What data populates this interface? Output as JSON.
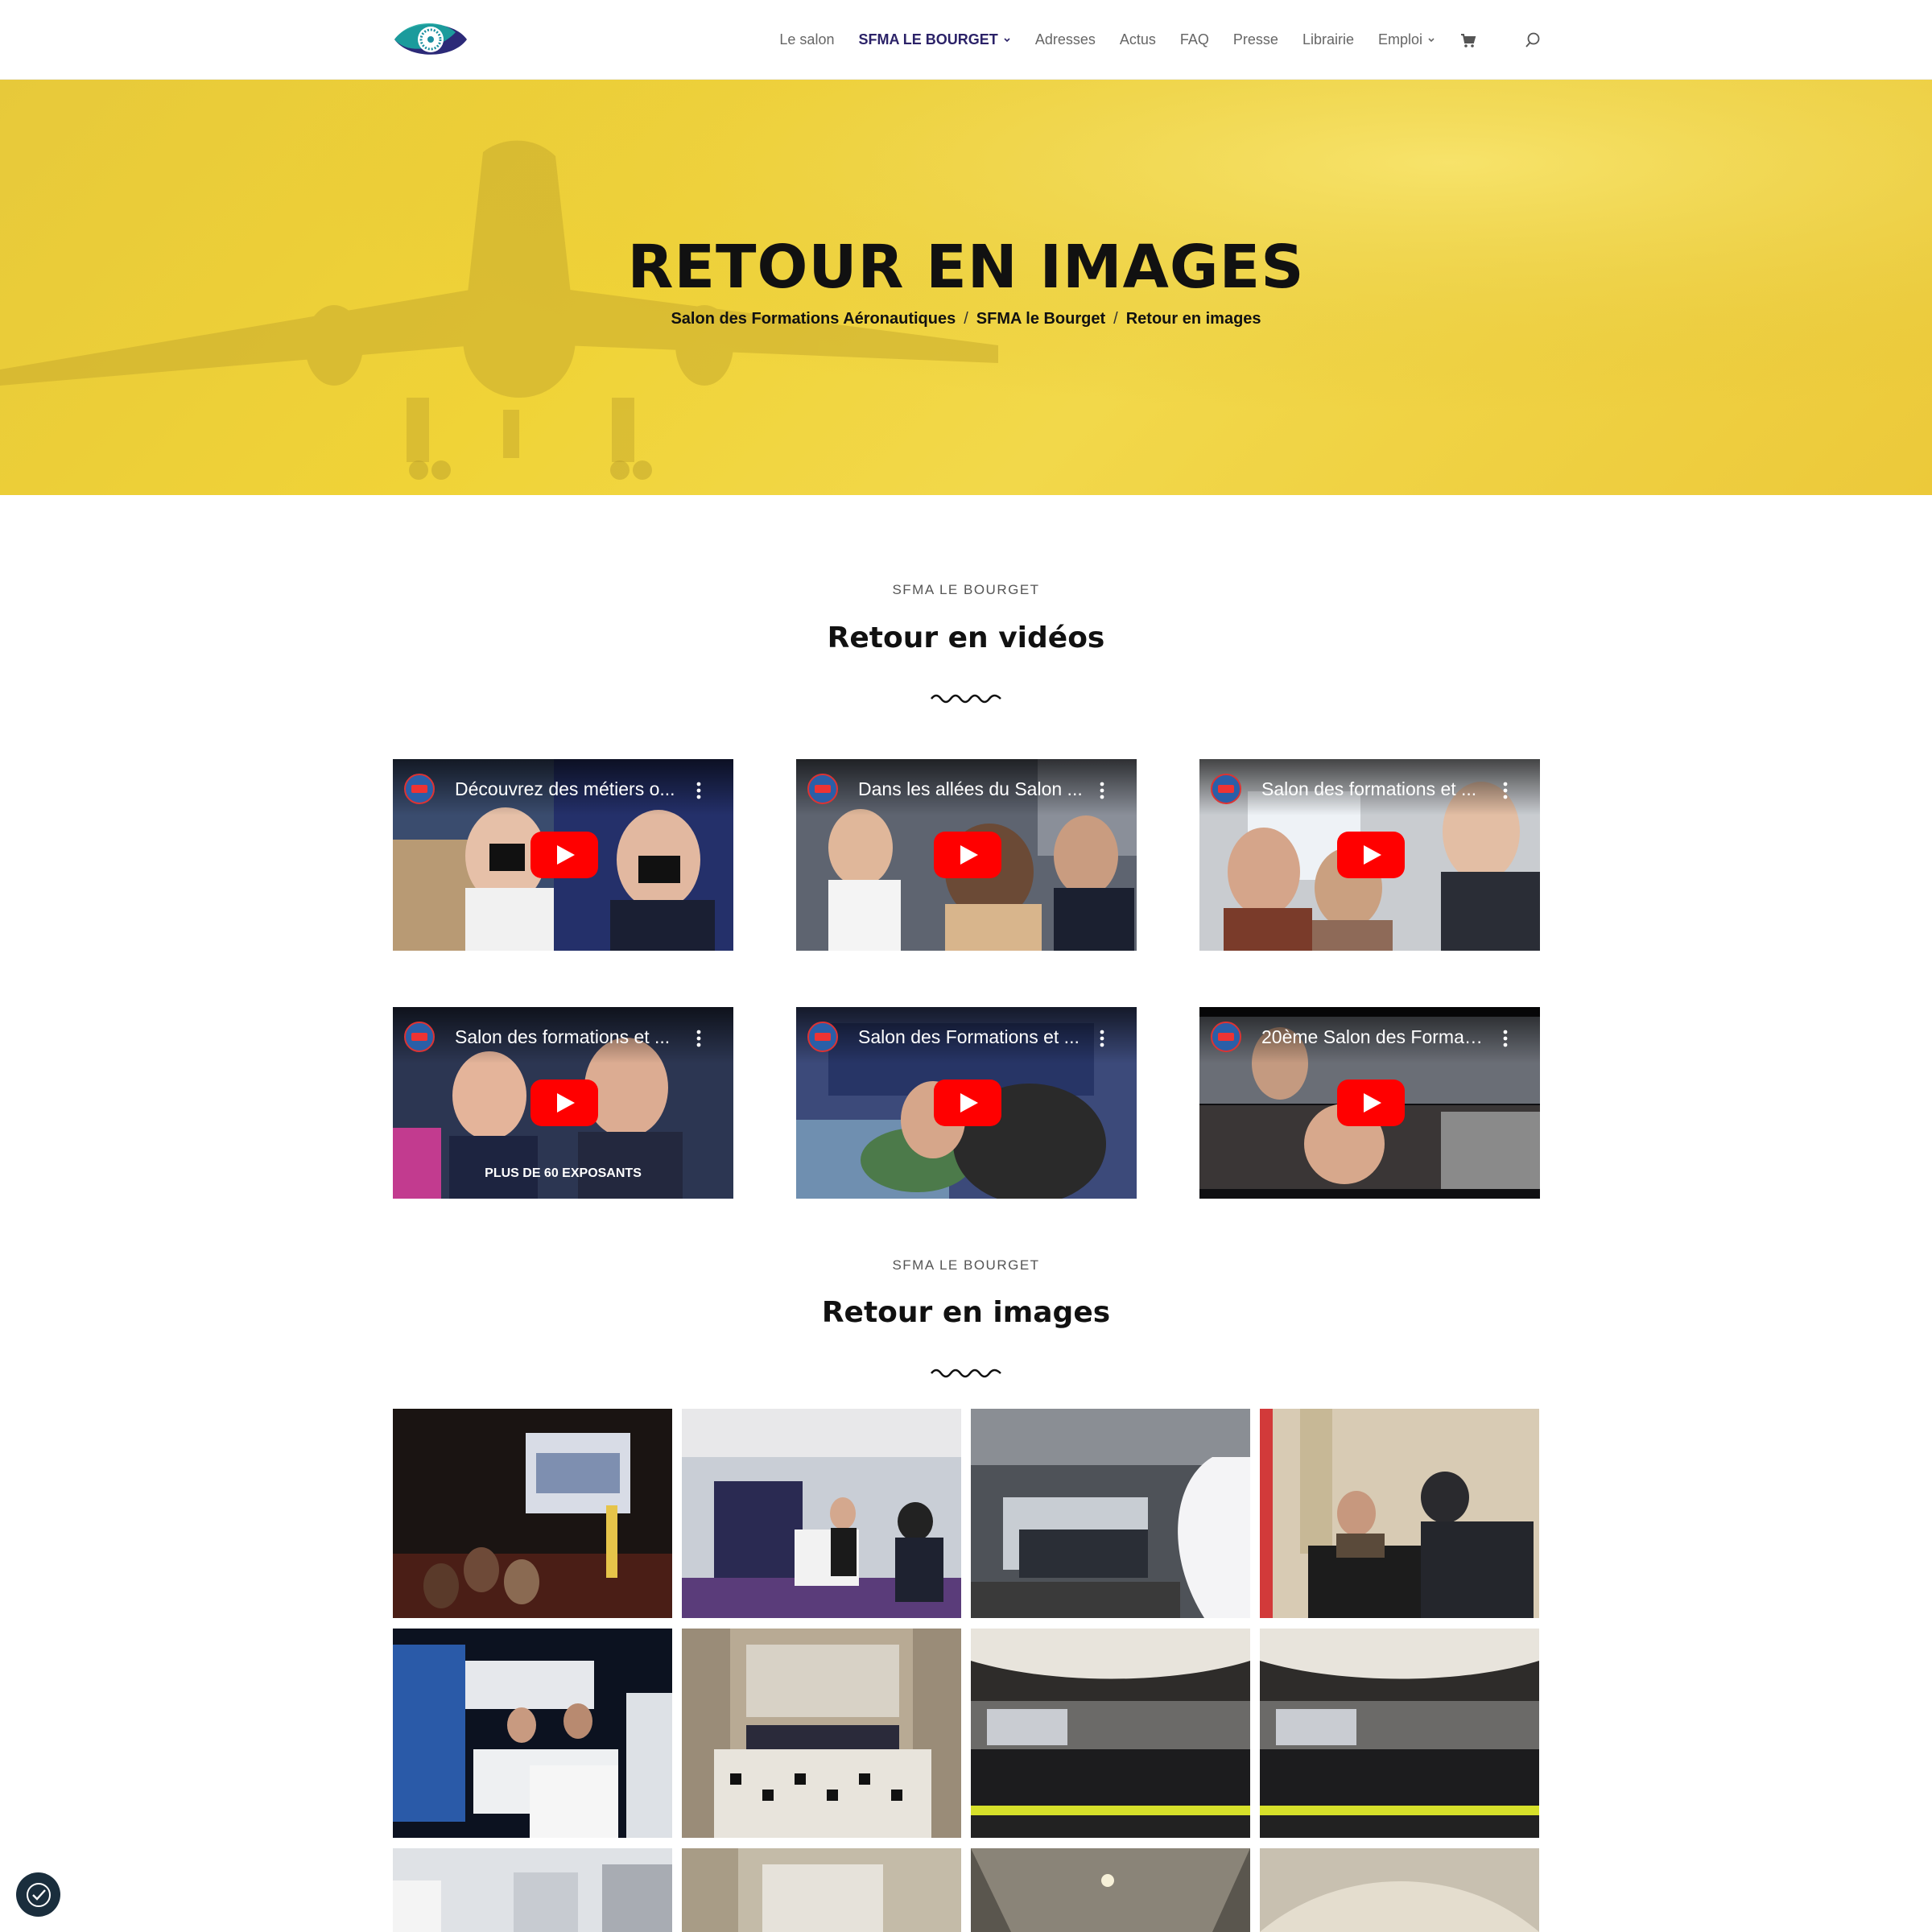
{
  "nav": {
    "items": [
      {
        "label": "Le salon",
        "active": false,
        "dropdown": false
      },
      {
        "label": "SFMA LE BOURGET",
        "active": true,
        "dropdown": true
      },
      {
        "label": "Adresses",
        "active": false,
        "dropdown": false
      },
      {
        "label": "Actus",
        "active": false,
        "dropdown": false
      },
      {
        "label": "FAQ",
        "active": false,
        "dropdown": false
      },
      {
        "label": "Presse",
        "active": false,
        "dropdown": false
      },
      {
        "label": "Librairie",
        "active": false,
        "dropdown": false
      },
      {
        "label": "Emploi",
        "active": false,
        "dropdown": true
      }
    ],
    "icons": [
      "cart-icon",
      "search-icon"
    ]
  },
  "hero": {
    "title": "RETOUR EN IMAGES",
    "breadcrumb": [
      "Salon des Formations Aéronautiques",
      "SFMA le Bourget",
      "Retour en images"
    ],
    "color": "#f0d337"
  },
  "videos_section": {
    "eyebrow": "SFMA LE BOURGET",
    "title": "Retour en vidéos"
  },
  "videos": [
    {
      "title": "Découvrez des métiers o...",
      "caption": ""
    },
    {
      "title": "Dans les allées du Salon ...",
      "caption": ""
    },
    {
      "title": "Salon des formations et ...",
      "caption": ""
    },
    {
      "title": "Salon des formations et ...",
      "caption": "PLUS DE 60 EXPOSANTS"
    },
    {
      "title": "Salon des Formations et ...",
      "caption": ""
    },
    {
      "title": "20ème Salon des Formati...",
      "caption": ""
    }
  ],
  "images_section": {
    "eyebrow": "SFMA LE BOURGET",
    "title": "Retour en images"
  },
  "colors": {
    "accent": "#2b2268",
    "play_button": "#ff0000"
  }
}
